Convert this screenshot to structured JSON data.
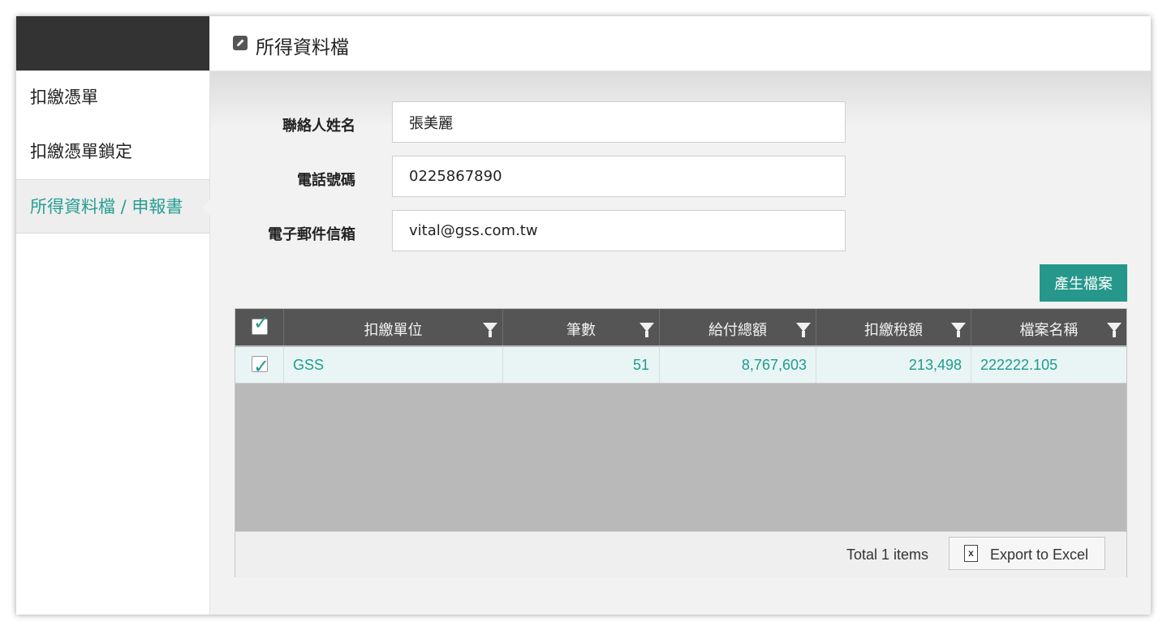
{
  "header": {
    "title": "所得資料檔",
    "icon": "edit-icon"
  },
  "sidebar": {
    "items": [
      {
        "label": "扣繳憑單"
      },
      {
        "label": "扣繳憑單鎖定"
      },
      {
        "label": "所得資料檔 / 申報書",
        "active": true
      }
    ]
  },
  "form": {
    "contact_name": {
      "label": "聯絡人姓名",
      "value": "張美麗"
    },
    "phone": {
      "label": "電話號碼",
      "value": "0225867890"
    },
    "email": {
      "label": "電子郵件信箱",
      "value": "vital@gss.com.tw"
    }
  },
  "generate_button": "產生檔案",
  "grid": {
    "columns": [
      "扣繳單位",
      "筆數",
      "給付總額",
      "扣繳稅額",
      "檔案名稱"
    ],
    "rows": [
      {
        "checked": true,
        "unit": "GSS",
        "count": "51",
        "total_paid": "8,767,603",
        "tax_withheld": "213,498",
        "file_name": "222222.105"
      }
    ],
    "footer": {
      "total_text": "Total 1 items",
      "export_label": "Export to Excel"
    }
  },
  "colors": {
    "accent": "#25978b",
    "sidebar_top": "#333333",
    "grid_header": "#555555",
    "grid_empty": "#b9b9b9"
  }
}
